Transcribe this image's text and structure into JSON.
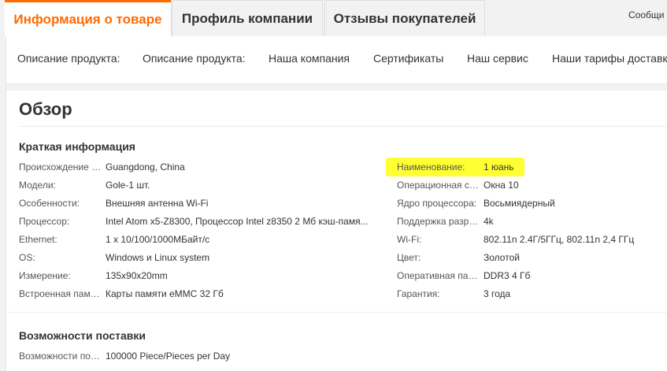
{
  "tabs": {
    "product_info": "Информация о товаре",
    "company_profile": "Профиль компании",
    "reviews": "Отзывы покупателей",
    "messages": "Сообщи"
  },
  "subnav": [
    "Описание продукта:",
    "Описание продукта:",
    "Наша компания",
    "Сертификаты",
    "Наш сервис",
    "Наши тарифы доставки"
  ],
  "overview": {
    "title": "Обзор",
    "quick_info_title": "Краткая информация",
    "left": [
      {
        "key": "Происхождение т...",
        "value": "Guangdong, China"
      },
      {
        "key": "Модели:",
        "value": "Gole-1 шт."
      },
      {
        "key": "Особенности:",
        "value": "Внешняя антенна Wi-Fi"
      },
      {
        "key": "Процессор:",
        "value": "Intel Atom x5-Z8300, Процессор Intel z8350 2 Мб кэш-памя..."
      },
      {
        "key": "Ethernet:",
        "value": "1 x 10/100/1000МБайт/с"
      },
      {
        "key": "OS:",
        "value": "Windows и Linux system"
      },
      {
        "key": "Измерение:",
        "value": "135x90x20mm"
      },
      {
        "key": "Встроенная памя...",
        "value": "Карты памяти eMMC 32 Гб"
      }
    ],
    "right": [
      {
        "key": "Наименование:",
        "value": "1 юань"
      },
      {
        "key": "Операционная си...",
        "value": "Окна 10"
      },
      {
        "key": "Ядро процессора:",
        "value": "Восьмиядерный"
      },
      {
        "key": "Поддержка разре...",
        "value": "4k"
      },
      {
        "key": "Wi-Fi:",
        "value": "802.11n 2.4Г/5ГГц, 802.11n 2,4 ГГц"
      },
      {
        "key": "Цвет:",
        "value": "Золотой"
      },
      {
        "key": "Оперативная пам...",
        "value": "DDR3 4 Гб"
      },
      {
        "key": "Гарантия:",
        "value": "3 года"
      }
    ]
  },
  "supply": {
    "title": "Возможности поставки",
    "key": "Возможности пост...",
    "value": "100000 Piece/Pieces per Day"
  },
  "colors": {
    "accent": "#ff6a00",
    "highlight": "#ffff33"
  }
}
